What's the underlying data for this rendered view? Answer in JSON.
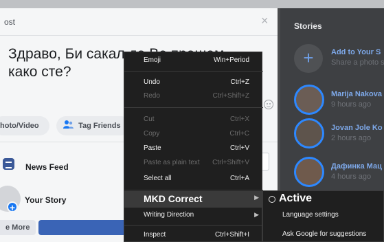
{
  "composer": {
    "title": "ost",
    "close_glyph": "×",
    "post_text": "Здраво, Би сакал да Ве прашам\nкако сте?",
    "photo_video_label": "hoto/Video",
    "tag_friends_label": "Tag Friends",
    "news_feed_label": "News Feed",
    "your_story_label": "Your Story",
    "more_label": "e More"
  },
  "stories": {
    "title": "Stories",
    "add": {
      "title": "Add to Your S",
      "subtitle": "Share a photo something"
    },
    "items": [
      {
        "name": "Marija Nakova",
        "time": "9 hours ago"
      },
      {
        "name": "Jovan Jole Ko",
        "time": "2 hours ago"
      },
      {
        "name": "Дафинка Мац",
        "time": "4 hours ago"
      }
    ]
  },
  "context_menu": {
    "items": [
      {
        "label": "Emoji",
        "shortcut": "Win+Period",
        "disabled": false
      },
      {
        "label": "Undo",
        "shortcut": "Ctrl+Z",
        "disabled": false
      },
      {
        "label": "Redo",
        "shortcut": "Ctrl+Shift+Z",
        "disabled": true
      },
      {
        "label": "Cut",
        "shortcut": "Ctrl+X",
        "disabled": true
      },
      {
        "label": "Copy",
        "shortcut": "Ctrl+C",
        "disabled": true
      },
      {
        "label": "Paste",
        "shortcut": "Ctrl+V",
        "disabled": false
      },
      {
        "label": "Paste as plain text",
        "shortcut": "Ctrl+Shift+V",
        "disabled": true
      },
      {
        "label": "Select all",
        "shortcut": "Ctrl+A",
        "disabled": false
      },
      {
        "label": "MKD Correct",
        "shortcut": "",
        "submenu": true
      },
      {
        "label": "Writing Direction",
        "shortcut": "",
        "submenu": true
      },
      {
        "label": "Inspect",
        "shortcut": "Ctrl+Shift+I",
        "disabled": false
      }
    ]
  },
  "submenu": {
    "active_label": "Active",
    "language_settings": "Language settings",
    "ask_google": "Ask Google for suggestions"
  },
  "icons": {
    "close": "close-icon",
    "emoji": "emoji-icon",
    "tag_friends": "tag-friends-icon",
    "news_feed": "news-feed-icon",
    "add_story": "plus-icon",
    "submenu_arrow": "chevron-right-icon",
    "radio": "radio-icon"
  },
  "colors": {
    "brand": "#3b5998",
    "story_ring": "#2d88ff",
    "menu_bg": "#1f1f1f"
  }
}
